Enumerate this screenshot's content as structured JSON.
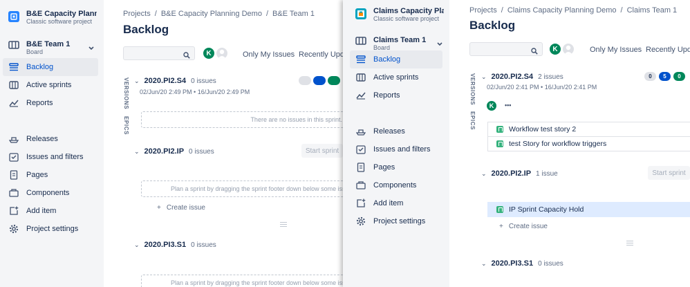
{
  "left": {
    "project": {
      "title": "B&E Capacity Planning Demo",
      "subtitle": "Classic software project"
    },
    "board": {
      "name": "B&E Team 1",
      "type": "Board"
    },
    "nav": [
      "Backlog",
      "Active sprints",
      "Reports"
    ],
    "nav2": [
      "Releases",
      "Issues and filters",
      "Pages",
      "Components",
      "Add item",
      "Project settings"
    ],
    "breadcrumbs": [
      "Projects",
      "B&E Capacity Planning Demo",
      "B&E Team 1"
    ],
    "page_title": "Backlog",
    "search": {
      "value": "",
      "placeholder": ""
    },
    "avatar_initial": "K",
    "quick_filters": [
      "Only My Issues",
      "Recently Updated"
    ],
    "side_labels": [
      "VERSIONS",
      "EPICS"
    ],
    "sprints": [
      {
        "name": "2020.PI2.S4",
        "count": "0 issues",
        "dates": "02/Jun/20 2:49 PM  •  16/Jun/20 2:49 PM",
        "empty_text": "There are no issues in this sprint."
      },
      {
        "name": "2020.PI2.IP",
        "count": "0 issues",
        "button": "Start sprint",
        "plan_text": "Plan a sprint by dragging the sprint footer down below some issues, or b",
        "create": "Create issue"
      },
      {
        "name": "2020.PI3.S1",
        "count": "0 issues",
        "plan_text": "Plan a sprint by dragging the sprint footer down below some issues, or b"
      }
    ]
  },
  "right": {
    "project": {
      "title": "Claims Capacity Planning",
      "subtitle": "Classic software project"
    },
    "board": {
      "name": "Claims Team 1",
      "type": "Board"
    },
    "nav": [
      "Backlog",
      "Active sprints",
      "Reports"
    ],
    "nav2": [
      "Releases",
      "Issues and filters",
      "Pages",
      "Components",
      "Add item",
      "Project settings"
    ],
    "breadcrumbs": [
      "Projects",
      "Claims Capacity Planning Demo",
      "Claims Team 1"
    ],
    "page_title": "Backlog",
    "search": {
      "value": "",
      "placeholder": ""
    },
    "avatar_initial": "K",
    "quick_filters": [
      "Only My Issues",
      "Recently Updated"
    ],
    "side_labels": [
      "VERSIONS",
      "EPICS"
    ],
    "sprints": [
      {
        "name": "2020.PI2.S4",
        "count": "2 issues",
        "dates": "02/Jun/20 2:41 PM  •  16/Jun/20 2:41 PM",
        "pills": [
          "0",
          "5",
          "0"
        ],
        "assignee": "K",
        "more": "•••",
        "issues": [
          "Workflow test story 2",
          "test Story for workflow triggers"
        ]
      },
      {
        "name": "2020.PI2.IP",
        "count": "1 issue",
        "button": "Start sprint",
        "issues": [
          "IP Sprint Capacity Hold"
        ],
        "create": "Create issue"
      },
      {
        "name": "2020.PI3.S1",
        "count": "0 issues"
      }
    ]
  },
  "colors": {
    "accent": "#0052cc",
    "green": "#00875a",
    "story": "#36b37e",
    "sidebar": "#f4f5f7"
  }
}
